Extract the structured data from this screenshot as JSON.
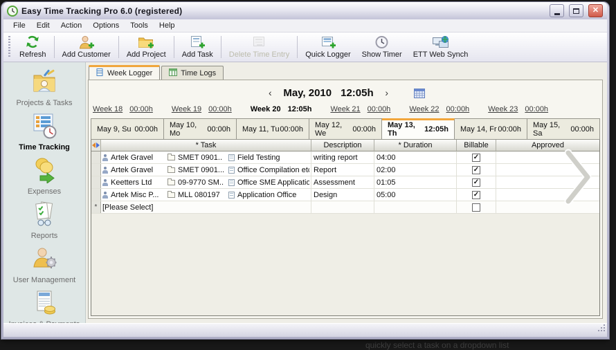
{
  "window": {
    "title": "Easy Time Tracking Pro 6.0 (registered)",
    "close_glyph": "✕"
  },
  "menu": {
    "items": [
      "File",
      "Edit",
      "Action",
      "Options",
      "Tools",
      "Help"
    ]
  },
  "toolbar": {
    "buttons": [
      {
        "label": "Refresh",
        "enabled": true
      },
      {
        "label": "Add Customer",
        "enabled": true
      },
      {
        "label": "Add Project",
        "enabled": true
      },
      {
        "label": "Add Task",
        "enabled": true
      },
      {
        "label": "Delete Time Entry",
        "enabled": false
      },
      {
        "label": "Quick Logger",
        "enabled": true
      },
      {
        "label": "Show Timer",
        "enabled": true
      },
      {
        "label": "ETT Web Synch",
        "enabled": true
      }
    ]
  },
  "sidebar": {
    "items": [
      {
        "label": "Projects & Tasks",
        "active": false
      },
      {
        "label": "Time Tracking",
        "active": true
      },
      {
        "label": "Expenses",
        "active": false
      },
      {
        "label": "Reports",
        "active": false
      },
      {
        "label": "User Management",
        "active": false
      },
      {
        "label": "Invoices & Payments",
        "active": false
      }
    ]
  },
  "tabs": {
    "items": [
      {
        "label": "Week Logger",
        "active": true
      },
      {
        "label": "Time Logs",
        "active": false
      }
    ]
  },
  "month_nav": {
    "prev": "‹",
    "month": "May, 2010",
    "time": "12:05h",
    "next": "›"
  },
  "weeks": {
    "items": [
      {
        "label": "Week 18",
        "hours": "00:00h",
        "active": false
      },
      {
        "label": "Week 19",
        "hours": "00:00h",
        "active": false
      },
      {
        "label": "Week 20",
        "hours": "12:05h",
        "active": true
      },
      {
        "label": "Week 21",
        "hours": "00:00h",
        "active": false
      },
      {
        "label": "Week 22",
        "hours": "00:00h",
        "active": false
      },
      {
        "label": "Week 23",
        "hours": "00:00h",
        "active": false
      }
    ]
  },
  "days": {
    "items": [
      {
        "label": "May 9, Su",
        "hours": "00:00h",
        "active": false
      },
      {
        "label": "May 10, Mo",
        "hours": "00:00h",
        "active": false
      },
      {
        "label": "May 11, Tu",
        "hours": "00:00h",
        "active": false
      },
      {
        "label": "May 12, We",
        "hours": "00:00h",
        "active": false
      },
      {
        "label": "May 13, Th",
        "hours": "12:05h",
        "active": true
      },
      {
        "label": "May 14, Fr",
        "hours": "00:00h",
        "active": false
      },
      {
        "label": "May 15, Sa",
        "hours": "00:00h",
        "active": false
      }
    ]
  },
  "grid": {
    "headers": {
      "task": "* Task",
      "description": "Description",
      "duration": "* Duration",
      "billable": "Billable",
      "approved": "Approved"
    },
    "rows": [
      {
        "customer": "Artek Gravel",
        "project": "SMET 0901..",
        "task": "Field Testing",
        "description": "writing report",
        "duration": "04:00",
        "billable": true,
        "approved": ""
      },
      {
        "customer": "Artek Gravel",
        "project": "SMET 0901...",
        "task": "Office Compilation etc..",
        "description": "Report",
        "duration": "02:00",
        "billable": true,
        "approved": ""
      },
      {
        "customer": "Keetters Ltd",
        "project": "09-9770 SM..",
        "task": "Office SME Application",
        "description": "Assessment",
        "duration": "01:05",
        "billable": true,
        "approved": ""
      },
      {
        "customer": "Artek Misc P...",
        "project": "MLL 080197",
        "task": "Application Office",
        "description": "Design",
        "duration": "05:00",
        "billable": true,
        "approved": ""
      }
    ],
    "new_row": {
      "indicator": "*",
      "label": "[Please Select]",
      "billable": false
    }
  },
  "background_caption": "quickly select a task on a dropdown list"
}
